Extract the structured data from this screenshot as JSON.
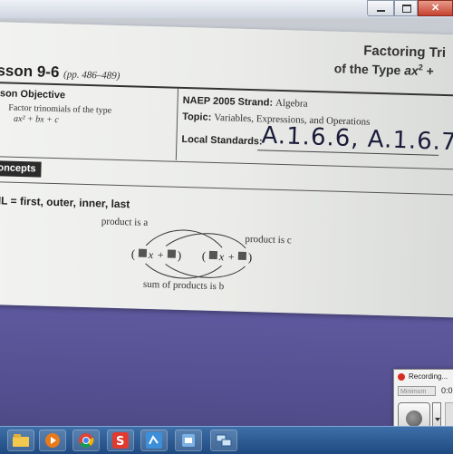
{
  "page": {
    "lesson_title": "sson 9-6",
    "lesson_pages": "(pp. 486–489)",
    "heading_line1": "Factoring Tri",
    "heading_line2_pre": "of the Type ",
    "heading_line2_math": "ax",
    "heading_line2_sup": "2",
    "heading_line2_post": " +",
    "objective_title": "sson Objective",
    "objective_text": "Factor trinomials of the type",
    "objective_formula": "ax² + bx + c",
    "naep_label": "NAEP 2005 Strand:",
    "naep_value": "Algebra",
    "topic_label": "Topic:",
    "topic_value": "Variables, Expressions, and Operations",
    "local_label": "Local Standards:",
    "local_value": "A.1.6.6, A.1.6.7",
    "concepts_tab": "Concepts",
    "foil_text": "OIL = first, outer, inner, last",
    "annotation_a": "product is a",
    "annotation_c": "product is c",
    "annotation_b": "sum of products is b",
    "binomial_1": "( x + )",
    "binomial_2": "( x + )"
  },
  "recorder": {
    "title": "Recording...",
    "dropdown": "Minimum",
    "timer": "0:0"
  },
  "taskbar": {
    "icons": [
      "folder-icon",
      "media-player-icon",
      "chrome-icon",
      "screencast-icon",
      "record-icon",
      "app-icon",
      "network-icon"
    ]
  },
  "colors": {
    "paper": "#ebece9",
    "table_surface": "#5a559a",
    "taskbar": "#2d5a94",
    "record_red": "#d62d20"
  }
}
